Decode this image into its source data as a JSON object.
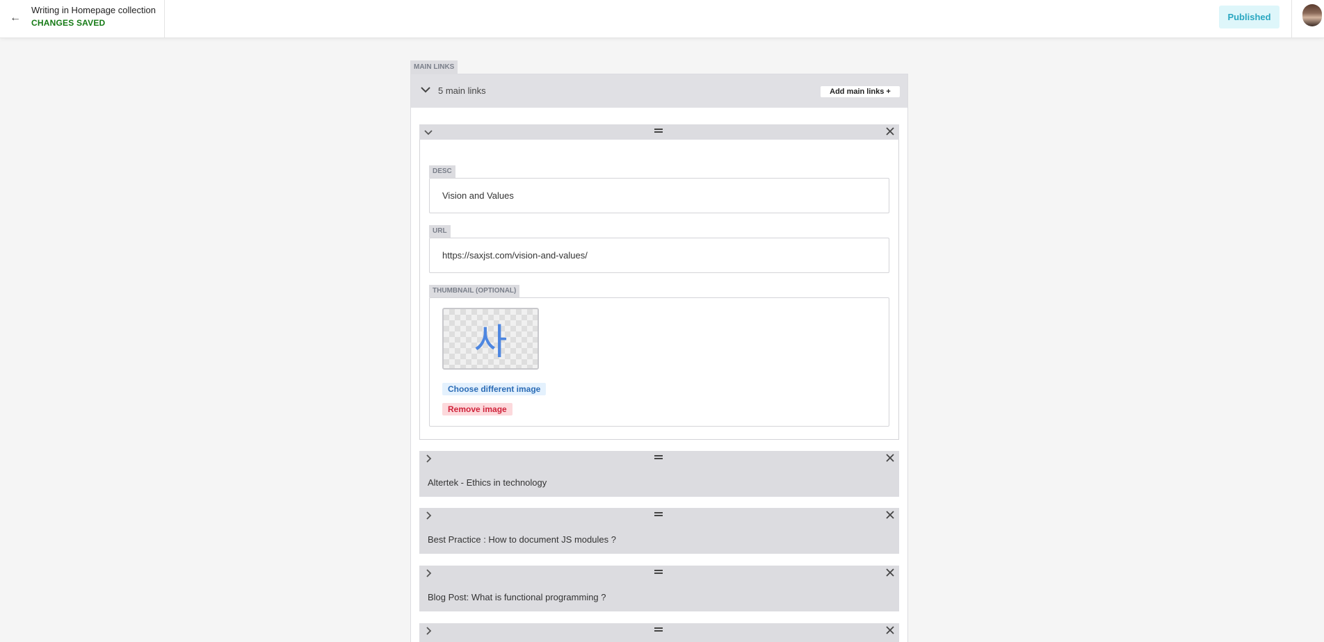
{
  "header": {
    "back_icon": "←",
    "title": "Writing in Homepage collection",
    "status": "CHANGES SAVED",
    "published_label": "Published"
  },
  "section": {
    "tag": "MAIN LINKS",
    "count_label": "5 main links",
    "add_label": "Add main links  +"
  },
  "open_item": {
    "desc_label": "DESC",
    "desc_value": "Vision and Values",
    "url_label": "URL",
    "url_value": "https://saxjst.com/vision-and-values/",
    "thumb_label": "THUMBNAIL (OPTIONAL)",
    "thumb_glyph": "사",
    "choose_label": "Choose different image",
    "remove_label": "Remove image"
  },
  "items": [
    {
      "title": "Altertek - Ethics in technology"
    },
    {
      "title": "Best Practice : How to document JS modules ?"
    },
    {
      "title": "Blog Post: What is functional programming ?"
    },
    {
      "title": ""
    }
  ],
  "colors": {
    "status_green": "#157a15",
    "published_bg": "#def6fa",
    "published_text": "#2aa7c1",
    "choose_text": "#2b6cb6",
    "remove_text": "#d0233b"
  }
}
